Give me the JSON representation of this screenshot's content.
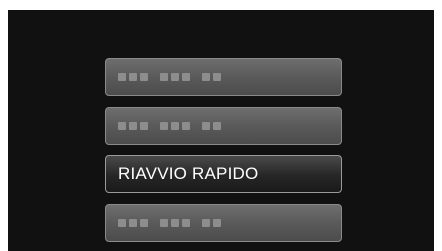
{
  "menu": {
    "items": [
      {
        "label": "",
        "state": "placeholder"
      },
      {
        "label": "",
        "state": "placeholder"
      },
      {
        "label": "RIAVVIO RAPIDO",
        "state": "selected"
      },
      {
        "label": "",
        "state": "placeholder"
      }
    ]
  }
}
